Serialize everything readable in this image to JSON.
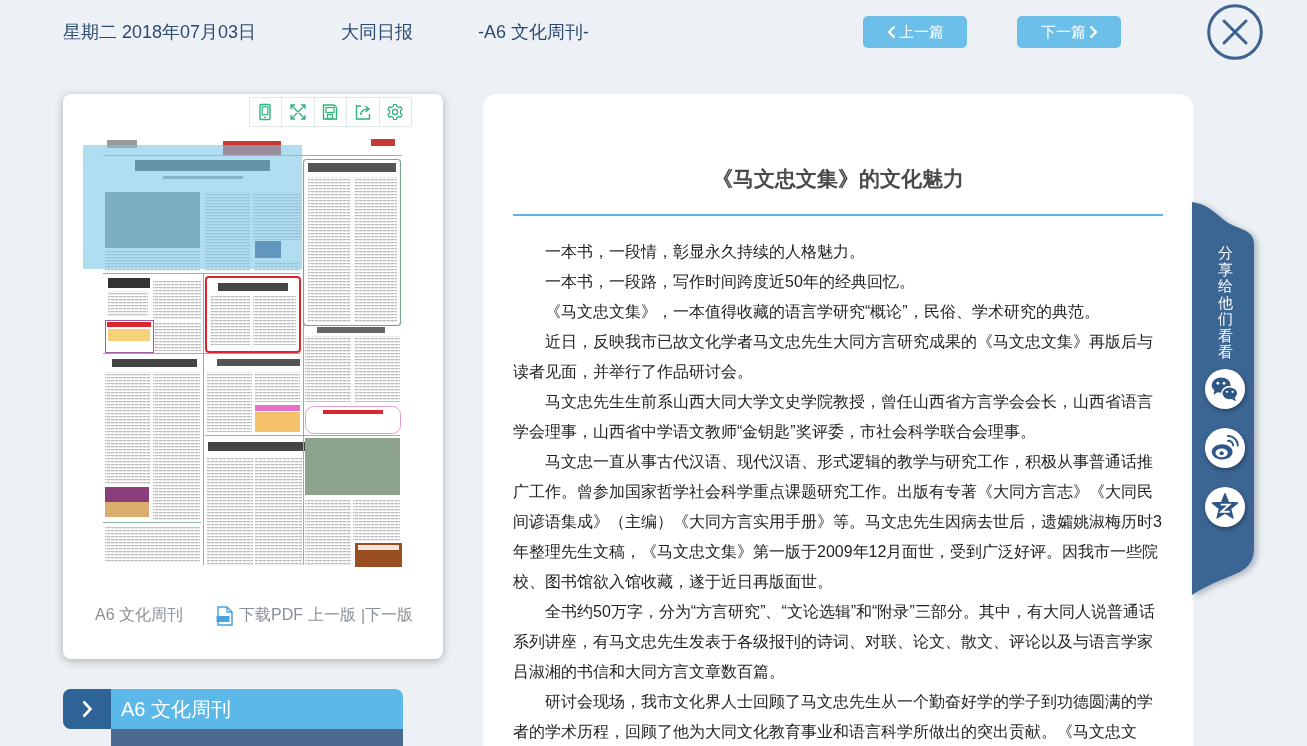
{
  "header": {
    "date": "星期二 2018年07月03日",
    "paper": "大同日报",
    "edition": "-A6 文化周刊-",
    "nav_buttons": [
      {
        "kind": "prev",
        "label": "上一篇"
      },
      {
        "kind": "next",
        "label": "下一篇"
      }
    ]
  },
  "page_viewer": {
    "edition_label": "A6 文化周刊",
    "links": [
      {
        "kind": "pdf",
        "label": "下载PDF"
      },
      {
        "kind": "prev",
        "label": "上一版"
      },
      {
        "kind": "separator",
        "label": "|"
      },
      {
        "kind": "next",
        "label": "下一版"
      }
    ]
  },
  "section_nav": {
    "label": "A6 文化周刊"
  },
  "article": {
    "title": "《马文忠文集》的文化魅力",
    "paragraphs": [
      "一本书，一段情，彰显永久持续的人格魅力。",
      "一本书，一段路，写作时间跨度近50年的经典回忆。",
      "《马文忠文集》，一本值得收藏的语言学研究“概论”，民俗、学术研究的典范。",
      "近日，反映我市已故文化学者马文忠先生大同方言研究成果的《马文忠文集》再版后与读者见面，并举行了作品研讨会。",
      "马文忠先生生前系山西大同大学文史学院教授，曾任山西省方言学会会长，山西省语言学会理事，山西省中学语文教师“金钥匙”奖评委，市社会科学联合会理事。",
      "马文忠一直从事古代汉语、现代汉语、形式逻辑的教学与研究工作，积极从事普通话推广工作。曾参加国家哲学社会科学重点课题研究工作。出版有专著《大同方言志》《大同民间谚语集成》（主编）《大同方言实用手册》等。马文忠先生因病去世后，遗孀姚淑梅历时3年整理先生文稿，《马文忠文集》第一版于2009年12月面世，受到广泛好评。因我市一些院校、图书馆欲入馆收藏，遂于近日再版面世。",
      "全书约50万字，分为“方言研究”、“文论选辑”和“附录”三部分。其中，有大同人说普通话系列讲座，有马文忠先生发表于各级报刊的诗词、对联、论文、散文、评论以及与语言学家吕淑湘的书信和大同方言文章数百篇。",
      "研讨会现场，我市文化界人士回顾了马文忠先生从一个勤奋好学的学子到功德圆满的学者的学术历程，回顾了他为大同文化教育事业和语言科学所做出的突出贡献。《马文忠文"
    ]
  },
  "share": {
    "label": "分享给他们看看"
  }
}
